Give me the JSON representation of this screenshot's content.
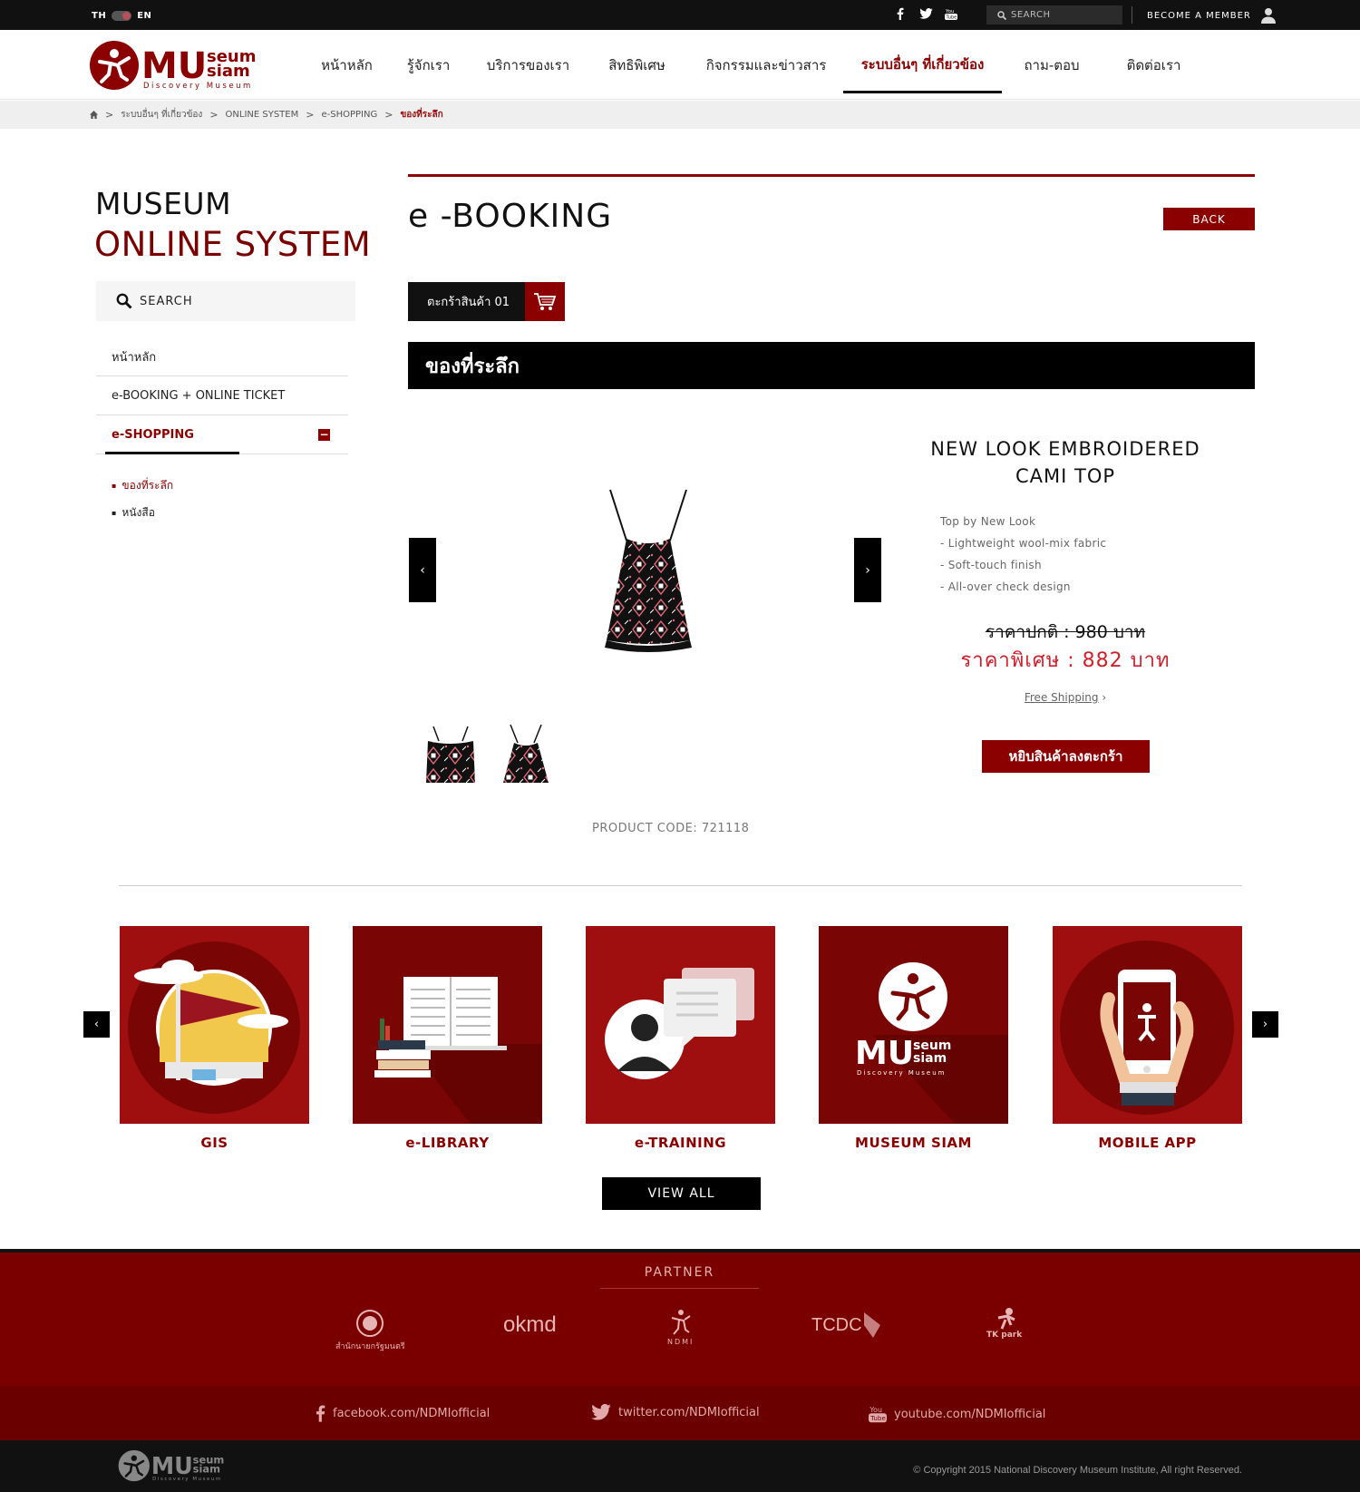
{
  "topbar": {
    "lang_th": "TH",
    "lang_en": "EN",
    "search_placeholder": "SEARCH",
    "member_label": "BECOME A MEMBER",
    "socials": [
      "facebook-icon",
      "twitter-icon",
      "youtube-icon"
    ]
  },
  "logo": {
    "line1": "seum",
    "line2": "siam",
    "big": "MU",
    "tagline": "Discovery Museum"
  },
  "nav": {
    "items": [
      {
        "label": "หน้าหลัก"
      },
      {
        "label": "รู้จักเรา"
      },
      {
        "label": "บริการของเรา"
      },
      {
        "label": "สิทธิพิเศษ"
      },
      {
        "label": "กิจกรรมและข่าวสาร"
      },
      {
        "label": "ระบบอื่นๆ ที่เกี่ยวข้อง",
        "active": true
      },
      {
        "label": "ถาม-ตอบ"
      },
      {
        "label": "ติดต่อเรา"
      }
    ]
  },
  "breadcrumb": {
    "items": [
      "ระบบอื่นๆ ที่เกี่ยวข้อง",
      "ONLINE SYSTEM",
      "e-SHOPPING"
    ],
    "current": "ของที่ระลึก"
  },
  "sidebar": {
    "title1": "MUSEUM",
    "title2": "ONLINE SYSTEM",
    "search_label": "SEARCH",
    "menu": [
      {
        "label": "หน้าหลัก"
      },
      {
        "label": "e-BOOKING + ONLINE TICKET"
      },
      {
        "label": "e-SHOPPING",
        "active": true
      }
    ],
    "submenu": [
      {
        "label": "ของที่ระลึก",
        "active": true
      },
      {
        "label": "หนังสือ"
      }
    ]
  },
  "main": {
    "title": "e -BOOKING",
    "back_label": "BACK",
    "cart_label": "ตะกร้าสินค้า 01",
    "section_title": "ของที่ระลึก"
  },
  "product": {
    "name": "NEW LOOK EMBROIDERED CAMI TOP",
    "description": [
      "Top by New Look",
      "- Lightweight wool-mix fabric",
      "- Soft-touch finish",
      "- All-over check design"
    ],
    "price_normal": "ราคาปกติ : 980 บาท",
    "price_special": "ราคาพิเศษ : 882 บาท",
    "shipping": "Free Shipping",
    "add_to_cart": "หยิบสินค้าลงตะกร้า",
    "code": "PRODUCT CODE: 721118"
  },
  "services": {
    "items": [
      {
        "label": "GIS",
        "icon": "map-flag-icon"
      },
      {
        "label": "e-LIBRARY",
        "icon": "book-icon"
      },
      {
        "label": "e-TRAINING",
        "icon": "chat-person-icon"
      },
      {
        "label": "MUSEUM SIAM",
        "icon": "museum-logo-icon"
      },
      {
        "label": "MOBILE APP",
        "icon": "mobile-icon"
      }
    ],
    "view_all": "VIEW ALL"
  },
  "footer": {
    "partner_title": "PARTNER",
    "partners": [
      {
        "label": "สำนักนายกรัฐมนตรี"
      },
      {
        "label": "okmd"
      },
      {
        "label": "NDMI"
      },
      {
        "label": "TCDC"
      },
      {
        "label": "TK park"
      }
    ],
    "social_links": [
      "facebook.com/NDMIofficial",
      "twitter.com/NDMIofficial",
      "youtube.com/NDMIofficial"
    ],
    "copyright": "Copyright 2015 National Discovery Museum Institute, All right Reserved."
  },
  "colors": {
    "brand_red": "#8b0000",
    "price_red": "#d0202a",
    "footer_red": "#7a0000"
  }
}
